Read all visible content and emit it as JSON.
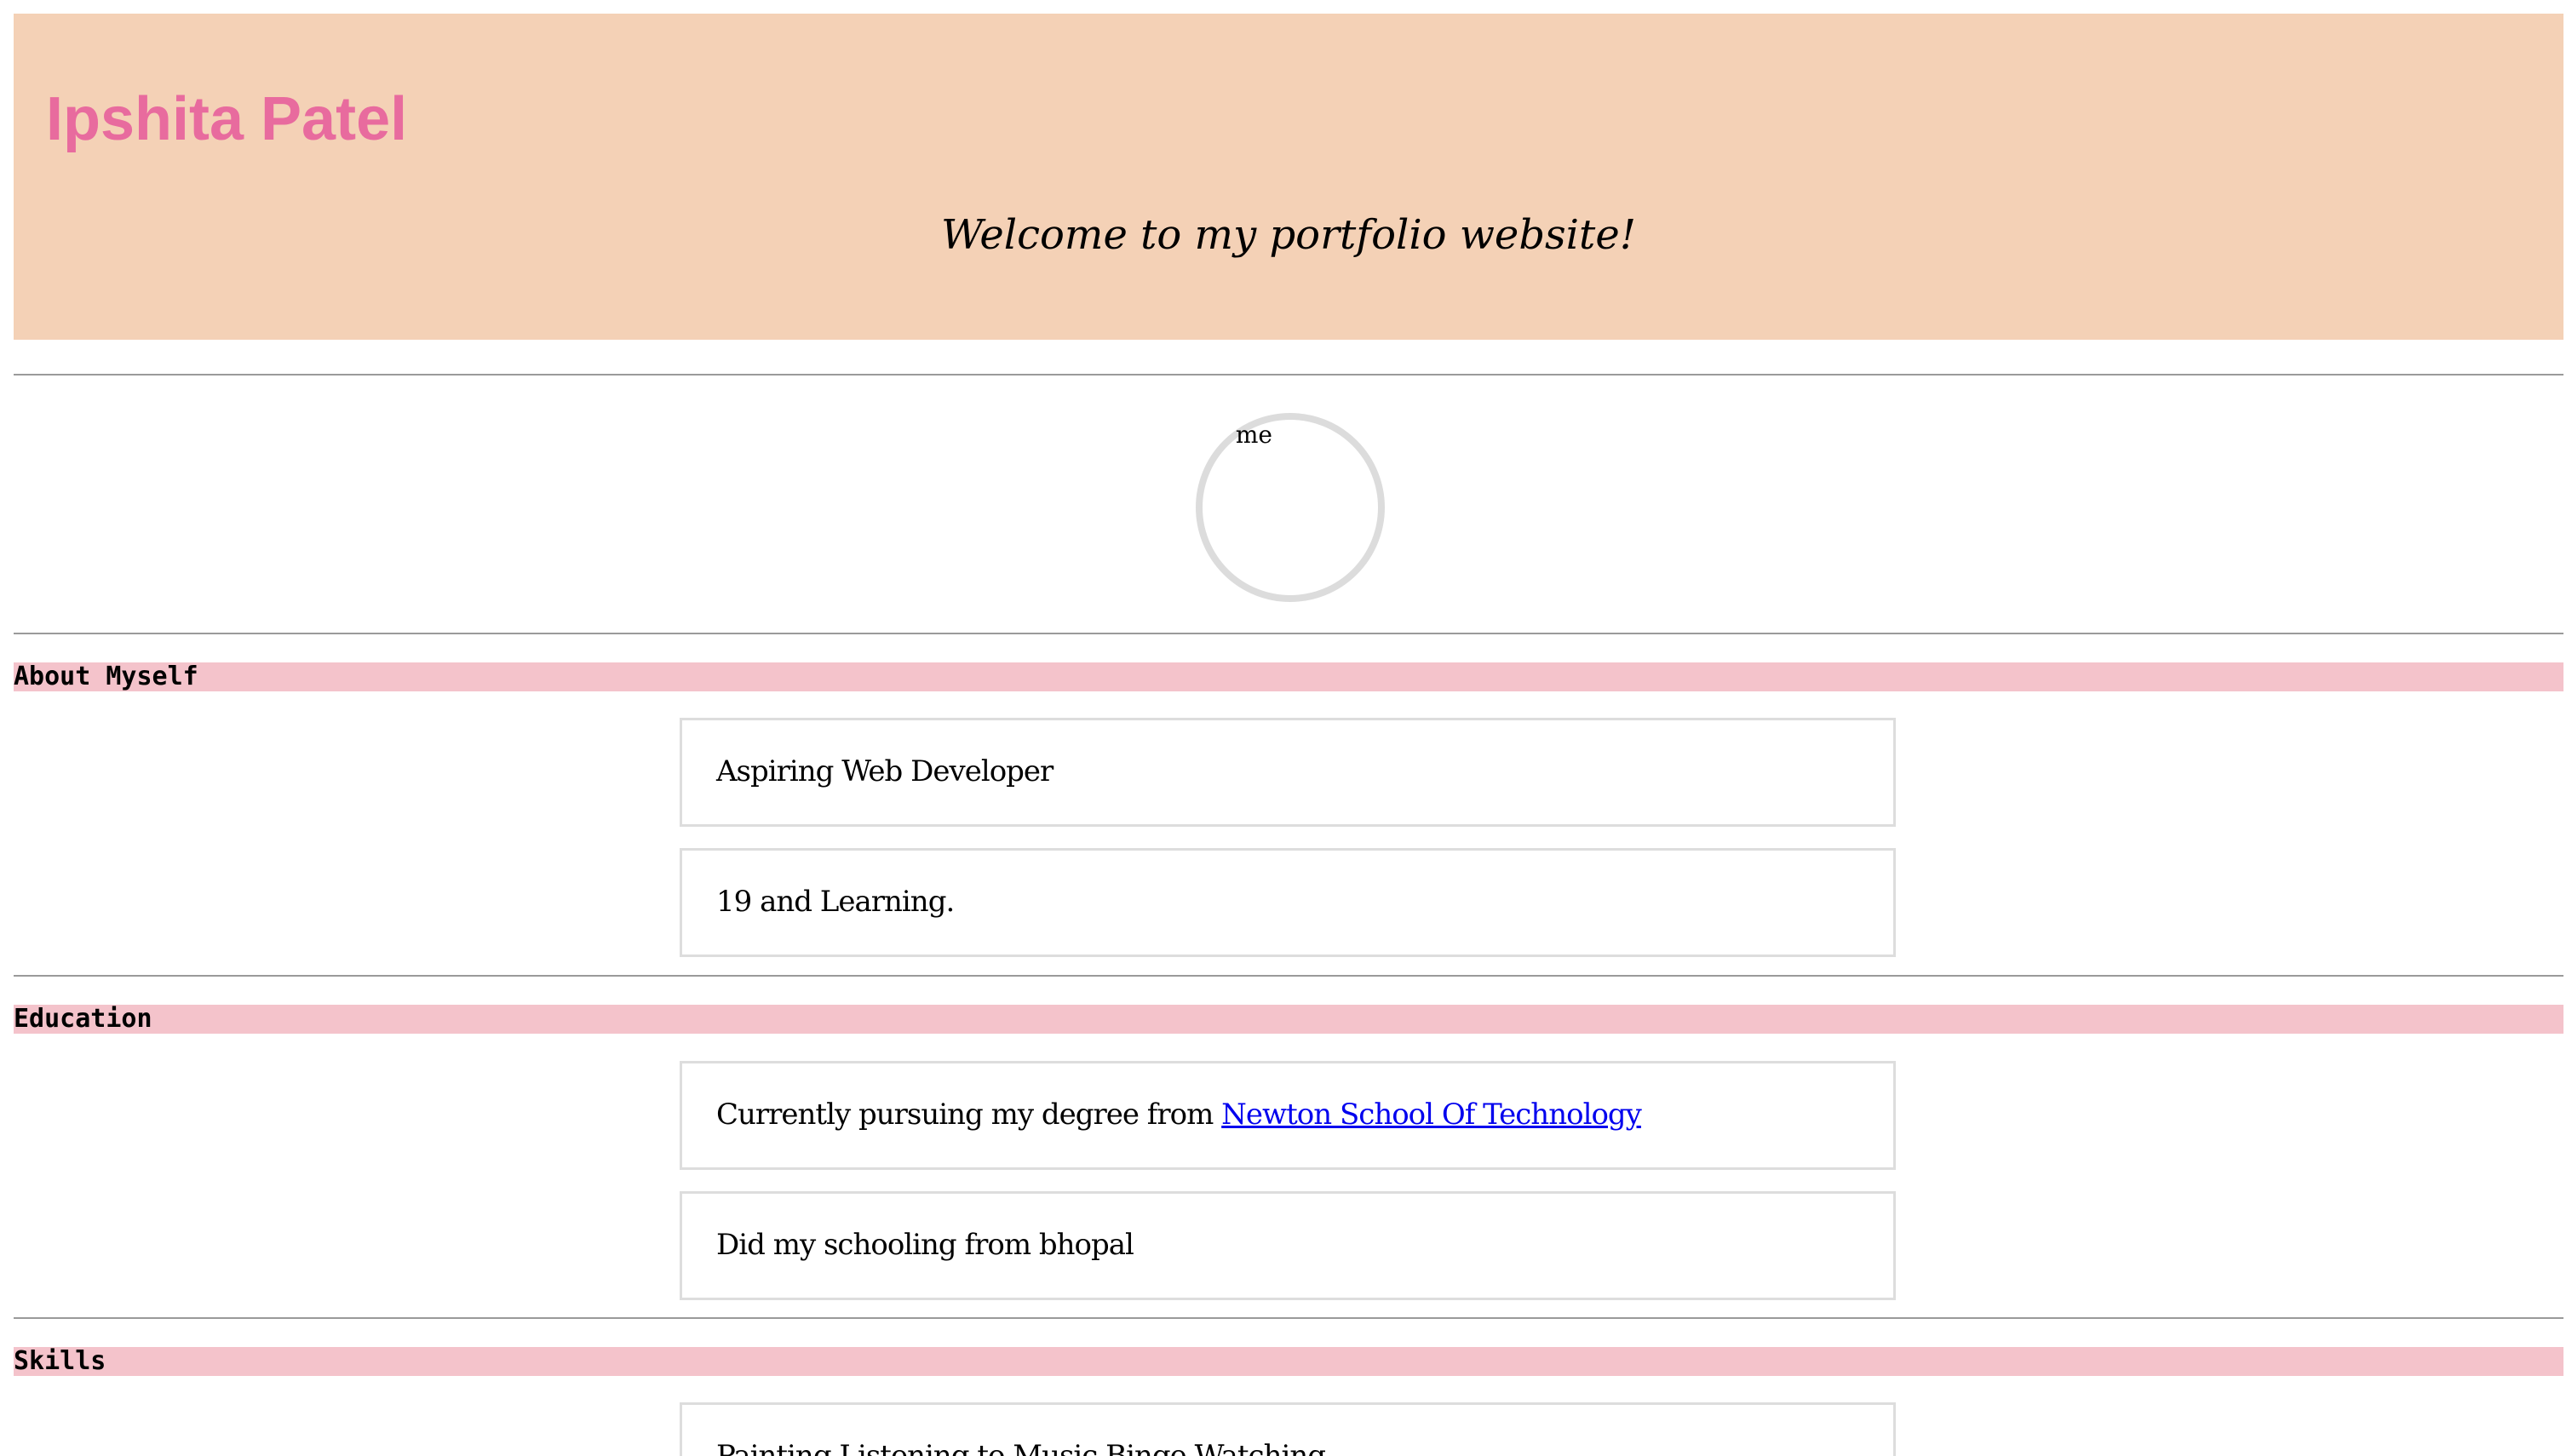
{
  "header": {
    "name": "Ipshita Patel",
    "welcome": "Welcome to my portfolio website!"
  },
  "avatar": {
    "alt_text": "me"
  },
  "sections": [
    {
      "title": "About Myself",
      "items": [
        "Aspiring Web Developer",
        "19 and Learning."
      ]
    },
    {
      "title": "Education",
      "items": [
        "Currently pursuing my degree from ",
        "Did my schooling from bhopal"
      ],
      "link_text": "Newton School Of Technology"
    },
    {
      "title": "Skills",
      "items": [
        "Painting,Listening to Music,Binge Watching"
      ]
    }
  ],
  "colors": {
    "header_bg": "#f4d1b6",
    "name_color": "#e86b9e",
    "section_bar": "#f4c3cb",
    "link": "#0000ee"
  }
}
